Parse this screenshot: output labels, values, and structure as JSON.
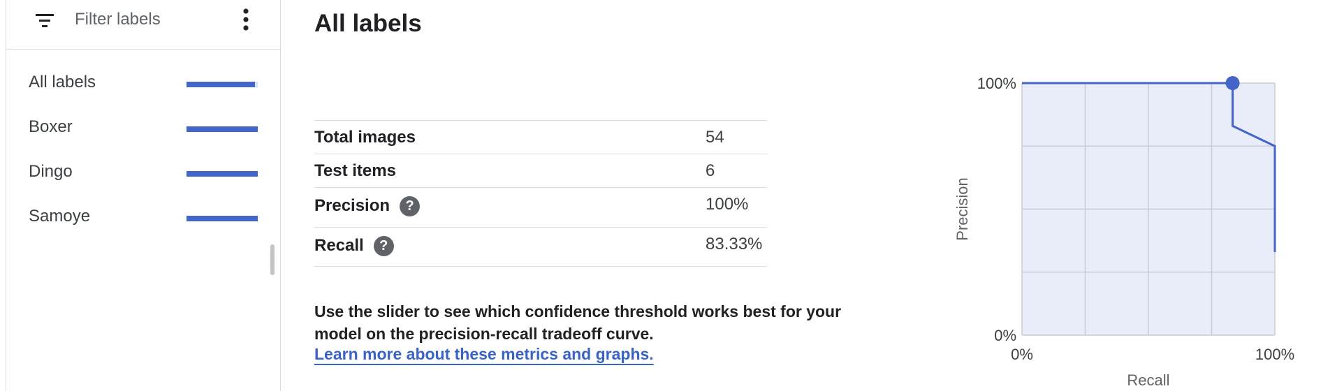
{
  "sidebar": {
    "filter": {
      "placeholder": "Filter labels",
      "value": "",
      "filter_icon": "filter-list-icon",
      "more_icon": "more-vert-icon"
    },
    "items": [
      {
        "label": "All labels",
        "fill_fraction": 0.96
      },
      {
        "label": "Boxer",
        "fill_fraction": 1.0
      },
      {
        "label": "Dingo",
        "fill_fraction": 1.0
      },
      {
        "label": "Samoye",
        "fill_fraction": 1.0
      }
    ]
  },
  "main": {
    "title": "All labels",
    "metrics": [
      {
        "name": "Total images",
        "value": "54",
        "help": false
      },
      {
        "name": "Test items",
        "value": "6",
        "help": false
      },
      {
        "name": "Precision",
        "value": "100%",
        "help": true
      },
      {
        "name": "Recall",
        "value": "83.33%",
        "help": true
      }
    ],
    "help_glyph": "?",
    "description": "Use the slider to see which confidence threshold works best for your model on the precision-recall tradeoff curve.",
    "learn_more": "Learn more about these metrics and graphs."
  },
  "colors": {
    "accent": "#4364c8",
    "chart_fill": "#e8edf9",
    "grid": "#c9ccd3",
    "link": "#3a63c6"
  },
  "chart_data": {
    "type": "line",
    "title": "",
    "xlabel": "Recall",
    "ylabel": "Precision",
    "xlim": [
      0,
      1
    ],
    "ylim": [
      0,
      1
    ],
    "x_ticks": [
      "0%",
      "100%"
    ],
    "y_ticks": [
      "0%",
      "100%"
    ],
    "grid": true,
    "series": [
      {
        "x": [
          0,
          0.833,
          0.833,
          1.0,
          1.0
        ],
        "y": [
          1.0,
          1.0,
          0.83,
          0.75,
          0.33
        ]
      }
    ],
    "marker": {
      "x": 0.833,
      "y": 1.0
    }
  }
}
